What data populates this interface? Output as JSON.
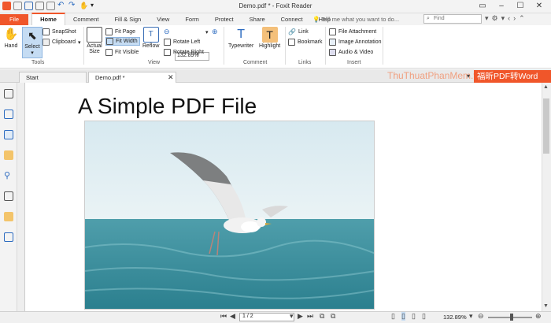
{
  "window": {
    "title": "Demo.pdf * - Foxit Reader"
  },
  "ribbon_tabs": [
    {
      "label": "File"
    },
    {
      "label": "Home"
    },
    {
      "label": "Comment"
    },
    {
      "label": "Fill & Sign"
    },
    {
      "label": "View"
    },
    {
      "label": "Form"
    },
    {
      "label": "Protect"
    },
    {
      "label": "Share"
    },
    {
      "label": "Connect"
    },
    {
      "label": "Help"
    }
  ],
  "tell_me": "Tell me what you want to do...",
  "find": {
    "placeholder": "Find"
  },
  "tools": {
    "hand": "Hand",
    "select": "Select",
    "snapshot": "SnapShot",
    "clipboard": "Clipboard",
    "group": "Tools"
  },
  "view": {
    "actual_size": "Actual Size",
    "fit_page": "Fit Page",
    "fit_width": "Fit Width",
    "fit_visible": "Fit Visible",
    "reflow": "Reflow",
    "zoom": "132.89%",
    "rotate_left": "Rotate Left",
    "rotate_right": "Rotate Right",
    "group": "View"
  },
  "comment": {
    "typewriter": "Typewriter",
    "highlight": "Highlight",
    "group": "Comment"
  },
  "links": {
    "link": "Link",
    "bookmark": "Bookmark",
    "group": "Links"
  },
  "insert": {
    "file_attachment": "File Attachment",
    "image_annotation": "Image Annotation",
    "audio_video": "Audio & Video",
    "group": "Insert"
  },
  "doc_tabs": [
    {
      "label": "Start"
    },
    {
      "label": "Demo.pdf *"
    }
  ],
  "watermark": "ThuThuatPhanMem.vn",
  "banner": "福昕PDF转Word",
  "document": {
    "title": "A Simple PDF File"
  },
  "status": {
    "page": "1 / 2",
    "zoom": "132.89%"
  },
  "colors": {
    "accent": "#f0562a",
    "select_bg": "#c5dcf3"
  }
}
